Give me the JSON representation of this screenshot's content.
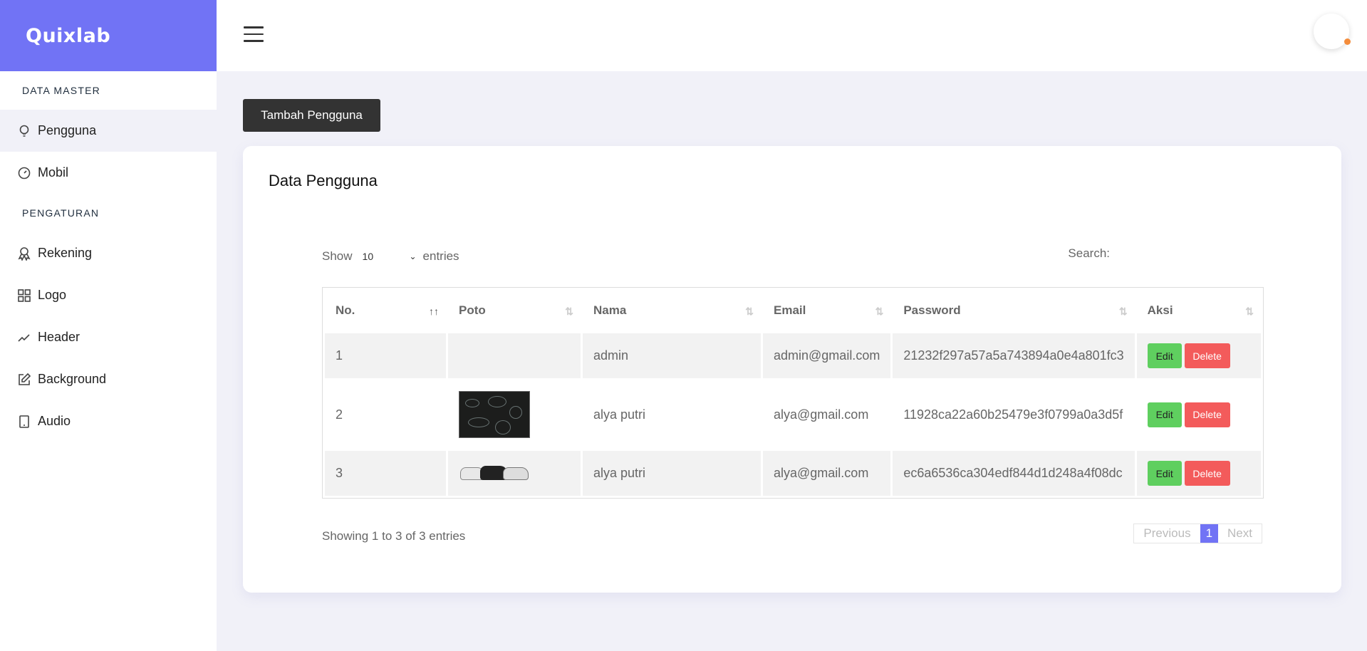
{
  "brand": "Quixlab",
  "sidebar": {
    "section1": "DATA MASTER",
    "section2": "PENGATURAN",
    "items": [
      {
        "label": "Pengguna"
      },
      {
        "label": "Mobil"
      },
      {
        "label": "Rekening"
      },
      {
        "label": "Logo"
      },
      {
        "label": "Header"
      },
      {
        "label": "Background"
      },
      {
        "label": "Audio"
      }
    ]
  },
  "main": {
    "add_button": "Tambah Pengguna",
    "card_title": "Data Pengguna",
    "show_label": "Show",
    "entries_value": "10",
    "entries_label": "entries",
    "search_label": "Search:",
    "columns": [
      "No.",
      "Poto",
      "Nama",
      "Email",
      "Password",
      "Aksi"
    ],
    "rows": [
      {
        "no": "1",
        "nama": "admin",
        "email": "admin@gmail.com",
        "password": "21232f297a57a5a743894a0e4a801fc3"
      },
      {
        "no": "2",
        "nama": "alya putri",
        "email": "alya@gmail.com",
        "password": "11928ca22a60b25479e3f0799a0a3d5f"
      },
      {
        "no": "3",
        "nama": "alya putri",
        "email": "alya@gmail.com",
        "password": "ec6a6536ca304edf844d1d248a4f08dc"
      }
    ],
    "edit_label": "Edit",
    "delete_label": "Delete",
    "info": "Showing 1 to 3 of 3 entries",
    "pager": {
      "prev": "Previous",
      "page": "1",
      "next": "Next"
    }
  },
  "colors": {
    "accent": "#7173f5",
    "edit": "#5fcf5f",
    "delete": "#f35b5b",
    "dark_button": "#333333"
  }
}
